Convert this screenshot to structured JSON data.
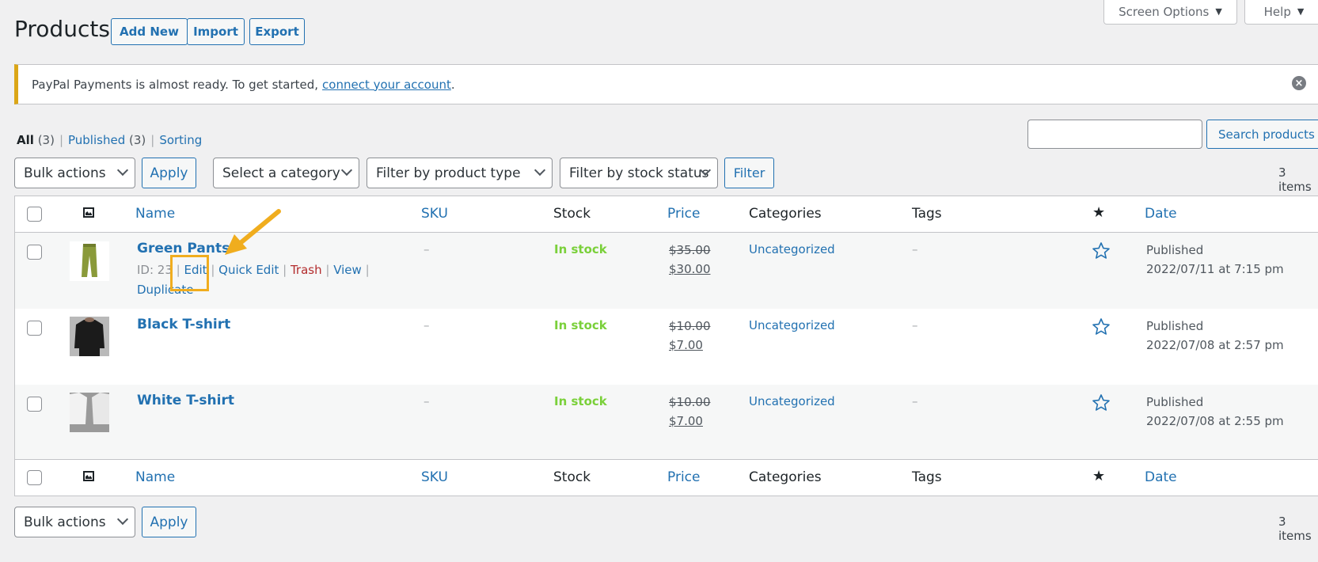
{
  "header": {
    "title": "Products",
    "buttons": [
      "Add New",
      "Import",
      "Export"
    ],
    "screen_options": "Screen Options",
    "help": "Help"
  },
  "notice": {
    "text": "PayPal Payments is almost ready. To get started,",
    "link": "connect your account",
    "suffix": ".",
    "dismiss_icon": "dismiss-circle-icon"
  },
  "views": {
    "all": {
      "label": "All",
      "count": "(3)"
    },
    "published": {
      "label": "Published",
      "count": "(3)"
    },
    "sorting": {
      "label": "Sorting"
    },
    "separator": "|"
  },
  "search": {
    "value": "",
    "placeholder": "",
    "button": "Search products"
  },
  "filters": {
    "bulk_actions": "Bulk actions",
    "apply": "Apply",
    "category": "Select a category",
    "product_type": "Filter by product type",
    "stock_status": "Filter by stock status",
    "filter": "Filter",
    "items_count": "3 items"
  },
  "columns": {
    "image_icon": "image-icon",
    "name": "Name",
    "sku": "SKU",
    "stock": "Stock",
    "price": "Price",
    "categories": "Categories",
    "tags": "Tags",
    "featured_icon": "star-icon",
    "date": "Date"
  },
  "products": [
    {
      "name": "Green Pants",
      "sku": "–",
      "stock": "In stock",
      "regular_price": "$35.00",
      "sale_price": "$30.00",
      "category": "Uncategorized",
      "tags": "–",
      "status": "Published",
      "date": "2022/07/11 at 7:15 pm",
      "row_actions": {
        "id": "ID: 23",
        "edit": "Edit",
        "quick_edit": "Quick Edit",
        "trash": "Trash",
        "view": "View",
        "duplicate": "Duplicate"
      }
    },
    {
      "name": "Black T-shirt",
      "sku": "–",
      "stock": "In stock",
      "regular_price": "$10.00",
      "sale_price": "$7.00",
      "category": "Uncategorized",
      "tags": "–",
      "status": "Published",
      "date": "2022/07/08 at 2:57 pm"
    },
    {
      "name": "White T-shirt",
      "sku": "–",
      "stock": "In stock",
      "regular_price": "$10.00",
      "sale_price": "$7.00",
      "category": "Uncategorized",
      "tags": "–",
      "status": "Published",
      "date": "2022/07/08 at 2:55 pm"
    }
  ],
  "colors": {
    "accent": "#2271b1",
    "notice_warning": "#dba617",
    "in_stock": "#7ad03a",
    "trash": "#b32d2e",
    "annotation": "#f0ad1e"
  }
}
